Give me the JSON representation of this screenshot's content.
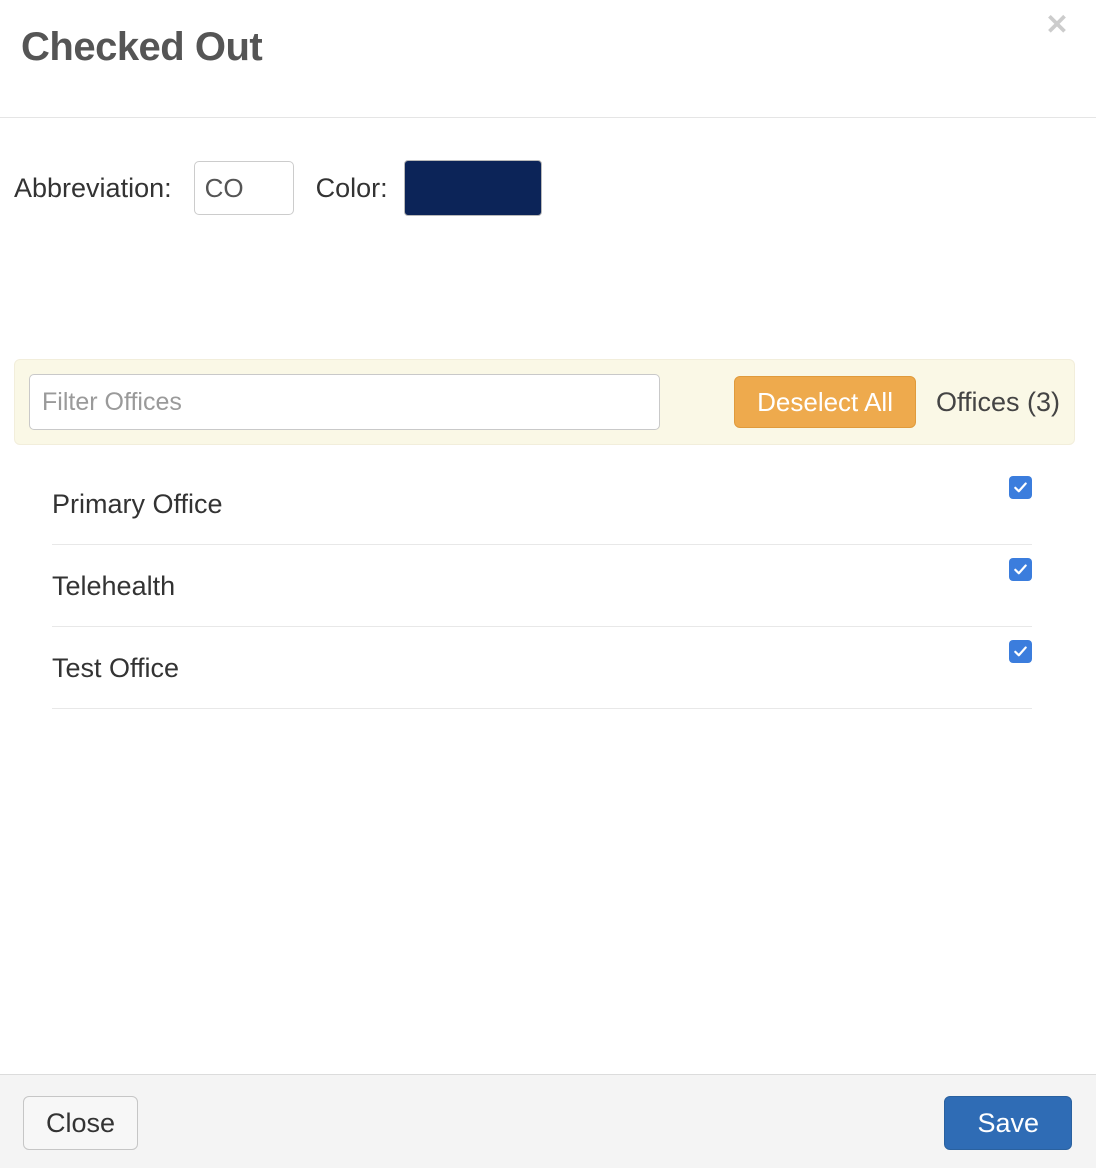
{
  "header": {
    "title": "Checked Out",
    "close_icon": "close-icon"
  },
  "attributes": {
    "abbreviation_label": "Abbreviation:",
    "abbreviation_value": "CO",
    "abbreviation_placeholder": "",
    "color_label": "Color:",
    "color_value": "#0c2458"
  },
  "filter": {
    "placeholder": "Filter Offices",
    "value": "",
    "deselect_label": "Deselect All",
    "count_label": "Offices (3)"
  },
  "offices": [
    {
      "name": "Primary Office",
      "checked": true
    },
    {
      "name": "Telehealth",
      "checked": true
    },
    {
      "name": "Test Office",
      "checked": true
    }
  ],
  "footer": {
    "close_label": "Close",
    "save_label": "Save"
  },
  "colors": {
    "accent_blue": "#3b7ddd",
    "save_blue": "#2f6cb5",
    "deselect_orange": "#eeaa4d",
    "filter_panel": "#faf8e6",
    "swatch_navy": "#0c2458"
  }
}
